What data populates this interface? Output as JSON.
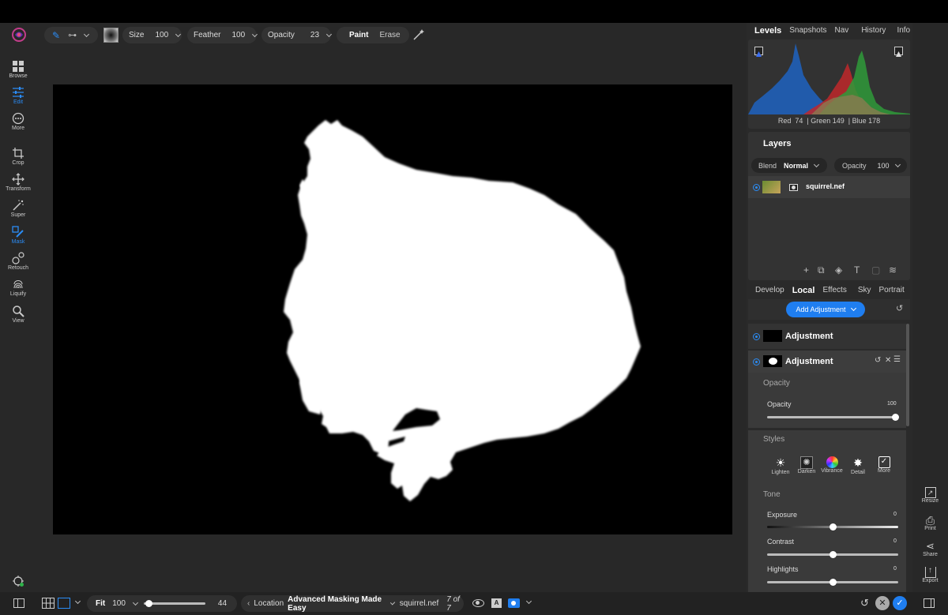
{
  "toolbar": {
    "size_label": "Size",
    "size_value": "100",
    "feather_label": "Feather",
    "feather_value": "100",
    "opacity_label": "Opacity",
    "opacity_value": "23",
    "paint_label": "Paint",
    "erase_label": "Erase"
  },
  "left_tools": [
    {
      "label": "Browse",
      "icon": "grid-icon"
    },
    {
      "label": "Edit",
      "icon": "sliders-icon"
    },
    {
      "label": "More",
      "icon": "more-icon"
    },
    {
      "label": "Crop",
      "icon": "crop-icon"
    },
    {
      "label": "Transform",
      "icon": "transform-icon"
    },
    {
      "label": "Super",
      "icon": "wand-icon"
    },
    {
      "label": "Mask",
      "icon": "mask-brush-icon"
    },
    {
      "label": "Retouch",
      "icon": "retouch-icon"
    },
    {
      "label": "Liquify",
      "icon": "liquify-icon"
    },
    {
      "label": "View",
      "icon": "zoom-icon"
    }
  ],
  "right_tabs": {
    "items": [
      "Levels",
      "Snapshots",
      "Nav",
      "History",
      "Info"
    ],
    "selected": "Levels"
  },
  "histogram": {
    "readout": "Red  74  | Green 149  | Blue 178",
    "colors": {
      "blue": "#1f5fb8",
      "red": "#c0282a",
      "green": "#2f9a3a"
    }
  },
  "layers": {
    "title": "Layers",
    "blend_label": "Blend",
    "blend_value": "Normal",
    "opacity_label": "Opacity",
    "opacity_value": "100",
    "layer_name": "squirrel.nef"
  },
  "local_tabs": {
    "items": [
      "Develop",
      "Local",
      "Effects",
      "Sky",
      "Portrait"
    ],
    "selected": "Local"
  },
  "add_adjustment_label": "Add Adjustment",
  "adjustments": [
    {
      "label": "Adjustment"
    },
    {
      "label": "Adjustment"
    }
  ],
  "opacity_section": {
    "title": "Opacity",
    "slider_label": "Opacity",
    "slider_value": "100",
    "level": 1.0
  },
  "styles": {
    "title": "Styles",
    "items": [
      "Lighten",
      "Darken",
      "Vibrance",
      "Detail",
      "More"
    ]
  },
  "tone": {
    "title": "Tone",
    "sliders": [
      {
        "label": "Exposure",
        "value": "0",
        "level": 0.5
      },
      {
        "label": "Contrast",
        "value": "0",
        "level": 0.5
      },
      {
        "label": "Highlights",
        "value": "0",
        "level": 0.5
      }
    ]
  },
  "far_right": [
    "Resize",
    "Print",
    "Share",
    "Export"
  ],
  "bottom": {
    "fit_label": "Fit",
    "zoom_value": "100",
    "zoom_level": 0.03,
    "slider_number": "44",
    "location_label": "Location",
    "album_name": "Advanced Masking Made Easy",
    "file_name": "squirrel.nef",
    "count_text": "7 of 7"
  },
  "accent_color": "#1f7ef0"
}
